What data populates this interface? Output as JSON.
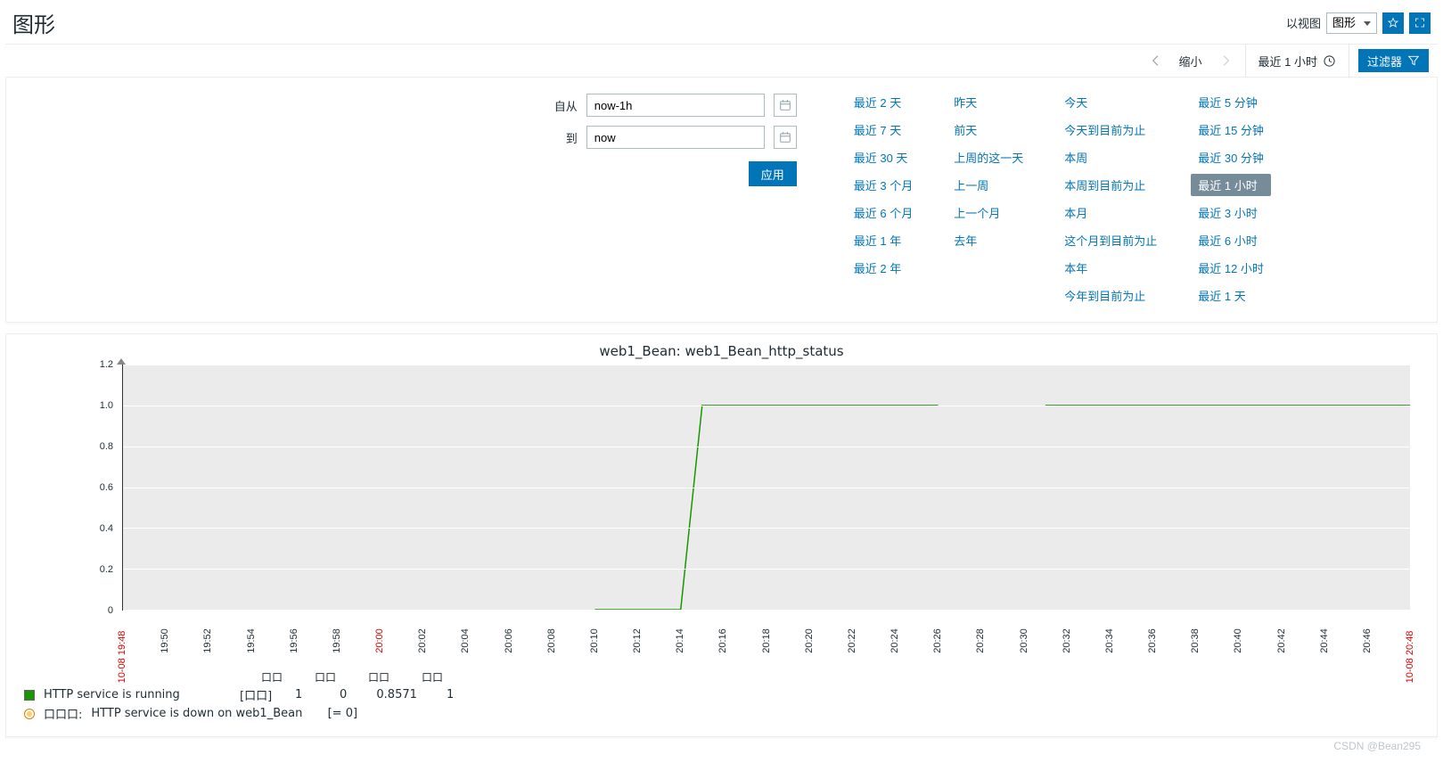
{
  "header": {
    "title": "图形",
    "view_label": "以视图",
    "view_select_value": "图形"
  },
  "toolbar": {
    "zoom_out": "缩小",
    "time_label": "最近 1 小时",
    "filter_label": "过滤器"
  },
  "time_form": {
    "from_label": "自从",
    "from_value": "now-1h",
    "to_label": "到",
    "to_value": "now",
    "apply": "应用"
  },
  "presets": {
    "col1": [
      "最近 2 天",
      "最近 7 天",
      "最近 30 天",
      "最近 3 个月",
      "最近 6 个月",
      "最近 1 年",
      "最近 2 年"
    ],
    "col2": [
      "昨天",
      "前天",
      "上周的这一天",
      "上一周",
      "上一个月",
      "去年"
    ],
    "col3": [
      "今天",
      "今天到目前为止",
      "本周",
      "本周到目前为止",
      "本月",
      "这个月到目前为止",
      "本年",
      "今年到目前为止"
    ],
    "col4": [
      "最近 5 分钟",
      "最近 15 分钟",
      "最近 30 分钟",
      "最近 1 小时",
      "最近 3 小时",
      "最近 6 小时",
      "最近 12 小时",
      "最近 1 天"
    ],
    "selected": "最近 1 小时"
  },
  "chart_data": {
    "type": "line",
    "title": "web1_Bean: web1_Bean_http_status",
    "x_start_label": "10-08 19:48",
    "x_end_label": "10-08 20:48",
    "x_ticks": [
      "19:50",
      "19:52",
      "19:54",
      "19:56",
      "19:58",
      "20:00",
      "20:02",
      "20:04",
      "20:06",
      "20:08",
      "20:10",
      "20:12",
      "20:14",
      "20:16",
      "20:18",
      "20:20",
      "20:22",
      "20:24",
      "20:26",
      "20:28",
      "20:30",
      "20:32",
      "20:34",
      "20:36",
      "20:38",
      "20:40",
      "20:42",
      "20:44",
      "20:46"
    ],
    "x_hour_ticks": [
      "20:00"
    ],
    "y_ticks": [
      0,
      0.2,
      0.4,
      0.6,
      0.8,
      1.0,
      1.2
    ],
    "ylim": [
      0,
      1.2
    ],
    "series": [
      {
        "name": "HTTP service is running",
        "points": [
          {
            "x": "20:10",
            "y": 0
          },
          {
            "x": "20:14",
            "y": 0
          },
          {
            "x": "20:15",
            "y": 1
          },
          {
            "x": "20:26",
            "y": 1
          },
          {
            "x": "20:26",
            "y": null
          },
          {
            "x": "20:31",
            "y": 1
          },
          {
            "x": "20:48",
            "y": 1
          }
        ],
        "stats": {
          "last": 1,
          "min": 0,
          "avg": 0.8571,
          "max": 1
        }
      }
    ],
    "trigger": {
      "label": "HTTP service is down on web1_Bean",
      "condition": "[= 0]"
    }
  },
  "legend": {
    "series_label": "HTTP service is running",
    "stat_col_headers": [
      "口口",
      "口口",
      "口口",
      "口口"
    ],
    "stat_group_label": "[口口]",
    "trigger_prefix": "口口口:",
    "trigger_label": "HTTP service is down on web1_Bean",
    "trigger_condition": "[= 0]",
    "values": {
      "last": "1",
      "min": "0",
      "avg": "0.8571",
      "max": "1"
    }
  },
  "watermark": "CSDN @Bean295"
}
